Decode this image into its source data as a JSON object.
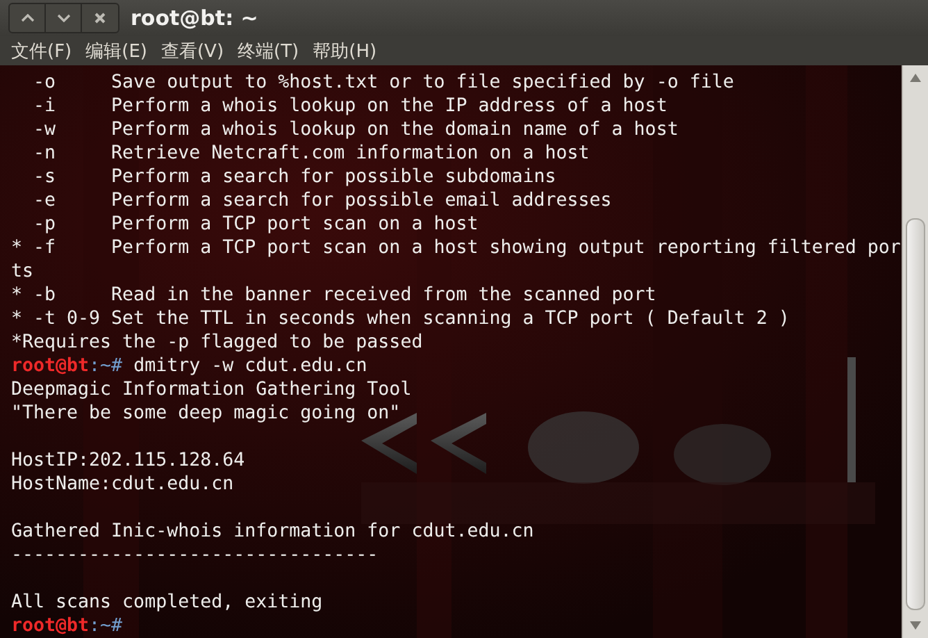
{
  "window": {
    "title": "root@bt: ~",
    "controls": [
      {
        "kind": "up"
      },
      {
        "kind": "down"
      },
      {
        "kind": "close"
      }
    ]
  },
  "menu": [
    "文件(F)",
    "编辑(E)",
    "查看(V)",
    "终端(T)",
    "帮助(H)"
  ],
  "terminal": {
    "lines": [
      {
        "kind": "text",
        "text": "  -o     Save output to %host.txt or to file specified by -o file"
      },
      {
        "kind": "text",
        "text": "  -i     Perform a whois lookup on the IP address of a host"
      },
      {
        "kind": "text",
        "text": "  -w     Perform a whois lookup on the domain name of a host"
      },
      {
        "kind": "text",
        "text": "  -n     Retrieve Netcraft.com information on a host"
      },
      {
        "kind": "text",
        "text": "  -s     Perform a search for possible subdomains"
      },
      {
        "kind": "text",
        "text": "  -e     Perform a search for possible email addresses"
      },
      {
        "kind": "text",
        "text": "  -p     Perform a TCP port scan on a host"
      },
      {
        "kind": "text",
        "text": "* -f     Perform a TCP port scan on a host showing output reporting filtered por"
      },
      {
        "kind": "text",
        "text": "ts"
      },
      {
        "kind": "text",
        "text": "* -b     Read in the banner received from the scanned port"
      },
      {
        "kind": "text",
        "text": "* -t 0-9 Set the TTL in seconds when scanning a TCP port ( Default 2 )"
      },
      {
        "kind": "text",
        "text": "*Requires the -p flagged to be passed"
      },
      {
        "kind": "prompt",
        "user": "root@bt",
        "path": ":~#",
        "command": " dmitry -w cdut.edu.cn"
      },
      {
        "kind": "text",
        "text": "Deepmagic Information Gathering Tool"
      },
      {
        "kind": "text",
        "text": "\"There be some deep magic going on\""
      },
      {
        "kind": "blank"
      },
      {
        "kind": "text",
        "text": "HostIP:202.115.128.64"
      },
      {
        "kind": "text",
        "text": "HostName:cdut.edu.cn"
      },
      {
        "kind": "blank"
      },
      {
        "kind": "text",
        "text": "Gathered Inic-whois information for cdut.edu.cn"
      },
      {
        "kind": "text",
        "text": "---------------------------------"
      },
      {
        "kind": "blank"
      },
      {
        "kind": "text",
        "text": "All scans completed, exiting"
      },
      {
        "kind": "prompt",
        "user": "root@bt",
        "path": ":~#"
      }
    ]
  }
}
